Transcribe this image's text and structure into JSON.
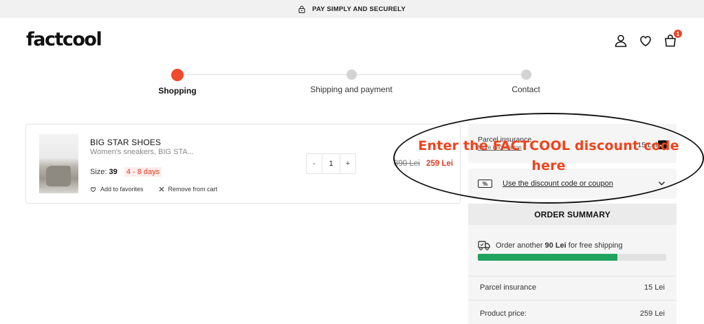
{
  "topbar": {
    "text": "PAY SIMPLY AND SECURELY",
    "icon": "lock-icon"
  },
  "header": {
    "logo": "factcool",
    "cart_count": "1",
    "icons": [
      "user-icon",
      "heart-icon",
      "bag-icon"
    ]
  },
  "steps": [
    {
      "label": "Shopping",
      "active": true
    },
    {
      "label": "Shipping and payment",
      "active": false
    },
    {
      "label": "Contact",
      "active": false
    }
  ],
  "cart_item": {
    "name": "BIG STAR SHOES",
    "description": "Women's sneakers, BIG STA...",
    "size_label": "Size:",
    "size": "39",
    "delivery": "4 - 8 days",
    "favorite_label": "Add to favorites",
    "remove_label": "Remove from cart",
    "qty_minus": "-",
    "quantity": "1",
    "qty_plus": "+",
    "old_price": "390 Lei",
    "new_price": "259 Lei"
  },
  "insurance": {
    "title": "Parcel insurance",
    "link": "More information",
    "price": "15 Lei"
  },
  "discount": {
    "icon_text": "%",
    "label": "Use the discount code or coupon"
  },
  "summary": {
    "title": "ORDER SUMMARY",
    "shipping_prefix": "Order another ",
    "shipping_amount": "90 Lei",
    "shipping_suffix": " for free shipping",
    "progress_fraction": 0.74,
    "rows": [
      {
        "label": "Parcel insurance",
        "value": "15 Lei"
      },
      {
        "label": "Product price:",
        "value": "259 Lei"
      }
    ]
  },
  "annotation": {
    "line1": "Enter the FACTCOOL discount code",
    "line2": "here"
  },
  "colors": {
    "accent": "#f14a2c",
    "sale": "#e23b22",
    "progress": "#20a35e"
  }
}
